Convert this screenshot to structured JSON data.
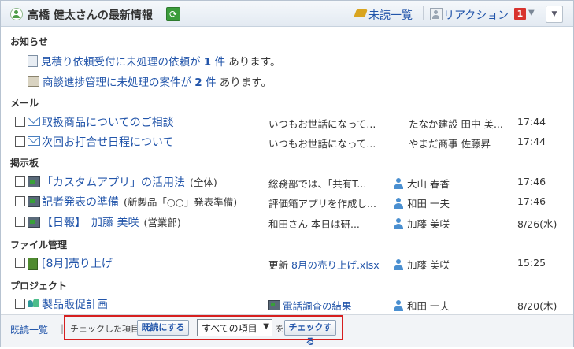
{
  "header": {
    "title": "高橋 健太さんの最新情報",
    "refresh_icon": "refresh-icon",
    "unread_label": "未読一覧",
    "reaction_label": "リアクション",
    "reaction_count": "1",
    "menu_icon": "chevron-down-icon"
  },
  "notices": {
    "section": "お知らせ",
    "items": [
      {
        "prefix": "見積り依頼受付に未処理の依頼が",
        "count": "1",
        "unit": "件",
        "suffix": "あります。"
      },
      {
        "prefix": "商談進捗管理に未処理の案件が",
        "count": "2",
        "unit": "件",
        "suffix": "あります。"
      }
    ]
  },
  "mail": {
    "section": "メール",
    "rows": [
      {
        "title": "取扱商品についてのご相談",
        "preview": "いつもお世話になって...",
        "sender": "たなか建設 田中 美...",
        "time": "17:44"
      },
      {
        "title": "次回お打合せ日程について",
        "preview": "いつもお世話になって...",
        "sender": "やまだ商事 佐藤昇",
        "time": "17:44"
      }
    ]
  },
  "board": {
    "section": "掲示板",
    "rows": [
      {
        "title": "「カスタムアプリ」の活用法",
        "sub": "(全体)",
        "preview": "総務部では、「共有T...",
        "person": "大山 春香",
        "time": "17:46"
      },
      {
        "title": "記者発表の準備",
        "sub": "(新製品「○○」発表準備)",
        "preview": "評価箱アプリを作成し...",
        "person": "和田 一夫",
        "time": "17:46"
      },
      {
        "title": "【日報】　加藤 美咲",
        "sub": "(営業部)",
        "preview": "和田さん 本日は研...",
        "person": "加藤 美咲",
        "time": "8/26(水)"
      }
    ]
  },
  "files": {
    "section": "ファイル管理",
    "rows": [
      {
        "title": "[8月]売り上げ",
        "preview_prefix": "更新",
        "preview_link": "8月の売り上げ.xlsx",
        "person": "加藤 美咲",
        "time": "15:25"
      }
    ]
  },
  "projects": {
    "section": "プロジェクト",
    "rows": [
      {
        "title": "製品販促計画",
        "preview_link": "電話調査の結果",
        "person": "和田 一夫",
        "time": "8/20(木)"
      }
    ]
  },
  "footer": {
    "read_list": "既読一覧",
    "separator": "|",
    "checked_label": "チェックした項目を",
    "mark_read_button": "既読にする",
    "select_value": "すべての項目",
    "wo": "を",
    "check_button": "チェックする"
  },
  "colors": {
    "link": "#2255aa",
    "highlight_box": "#d61f1f",
    "badge": "#d8332e"
  }
}
